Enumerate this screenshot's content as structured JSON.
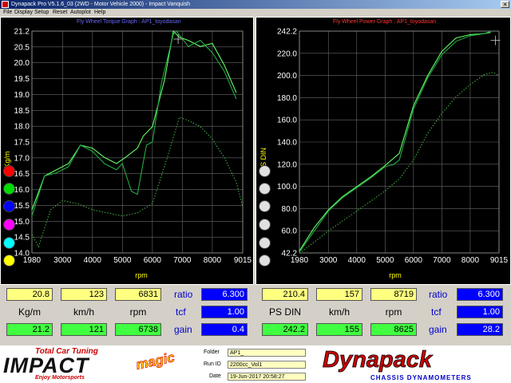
{
  "window": {
    "title": "Dynapack Pro V5.1.6_03 (2WD - Motor Vehicle 2000) - Impact Vanquish",
    "close_glyph": "✕"
  },
  "menu": [
    "File",
    "Display",
    "Setup",
    "Reset",
    "Autoplot",
    "Help"
  ],
  "torque_graph": {
    "title": "Fly Wheel Torque Graph : AP1_toyodasan",
    "ylabel": "Kg/m",
    "xlabel": "rpm",
    "yticks": [
      "21.2",
      "20.5",
      "20.0",
      "19.5",
      "19.0",
      "18.5",
      "18.0",
      "17.5",
      "17.0",
      "16.5",
      "16.0",
      "15.5",
      "15.0",
      "14.5",
      "14.0"
    ],
    "xticks": [
      "1980",
      "3000",
      "4000",
      "5000",
      "6000",
      "7000",
      "8000",
      "9015"
    ],
    "color": "#0000cc"
  },
  "power_graph": {
    "title": "Fly Wheel Power Graph : AP1_toyodasan",
    "ylabel": "PS DIN",
    "xlabel": "rpm",
    "yticks": [
      "242.2",
      "220.0",
      "200.0",
      "180.0",
      "160.0",
      "140.0",
      "120.0",
      "100.0",
      "80.0",
      "60.0",
      "42.2"
    ],
    "xticks": [
      "1980",
      "3000",
      "4000",
      "5000",
      "6000",
      "7000",
      "8000",
      "9015"
    ],
    "color": "#cc0000"
  },
  "chart_data": [
    {
      "type": "line",
      "title": "Fly Wheel Torque Graph : AP1_toyodasan",
      "xlabel": "rpm",
      "ylabel": "Kg/m",
      "xlim": [
        1980,
        9015
      ],
      "ylim": [
        14.0,
        21.2
      ],
      "grid": true,
      "series": [
        {
          "line": "solid-bright",
          "x": [
            1980,
            2400,
            2800,
            3200,
            3600,
            4000,
            4400,
            4800,
            5100,
            5500,
            5700,
            6000,
            6400,
            6700,
            6900,
            7200,
            7600,
            8000,
            8400,
            8800
          ],
          "y": [
            15.4,
            16.5,
            16.7,
            16.9,
            17.5,
            17.4,
            17.1,
            16.9,
            17.1,
            17.4,
            17.8,
            18.1,
            19.6,
            21.2,
            21.0,
            20.9,
            20.7,
            20.8,
            20.1,
            19.2
          ]
        },
        {
          "line": "solid-dark",
          "x": [
            1980,
            2400,
            2800,
            3200,
            3600,
            4000,
            4400,
            4800,
            5000,
            5300,
            5500,
            5800,
            6000,
            6300,
            6700,
            6800,
            7200,
            7600,
            8000,
            8400,
            8800
          ],
          "y": [
            15.2,
            16.5,
            16.6,
            16.8,
            17.5,
            17.3,
            16.9,
            16.7,
            16.9,
            16.0,
            15.9,
            17.5,
            17.6,
            19.5,
            21.1,
            21.2,
            20.7,
            20.9,
            20.5,
            19.9,
            19.0
          ]
        },
        {
          "line": "dotted",
          "x": [
            1980,
            2200,
            2600,
            3000,
            3500,
            4000,
            4500,
            5000,
            5500,
            6000,
            6500,
            6900,
            7200,
            7600,
            8000,
            8400,
            8800,
            9015
          ],
          "y": [
            14.6,
            14.2,
            15.4,
            15.7,
            15.6,
            15.4,
            15.3,
            15.2,
            15.3,
            15.6,
            17.1,
            18.4,
            18.3,
            18.1,
            17.7,
            17.1,
            16.3,
            15.5
          ]
        }
      ]
    },
    {
      "type": "line",
      "title": "Fly Wheel Power Graph : AP1_toyodasan",
      "xlabel": "rpm",
      "ylabel": "PS DIN",
      "xlim": [
        1980,
        9015
      ],
      "ylim": [
        42.2,
        242.2
      ],
      "grid": true,
      "series": [
        {
          "line": "solid-bright",
          "x": [
            1980,
            2500,
            3000,
            3500,
            4000,
            4500,
            5000,
            5500,
            6000,
            6500,
            7000,
            7500,
            8000,
            8500,
            8719
          ],
          "y": [
            44,
            65,
            81,
            93,
            102,
            111,
            121,
            132,
            175,
            202,
            224,
            236,
            239,
            240,
            241
          ]
        },
        {
          "line": "solid-dark",
          "x": [
            1980,
            2500,
            3000,
            3500,
            4000,
            4500,
            5000,
            5300,
            5500,
            6000,
            6500,
            7000,
            7500,
            8000,
            8500,
            8719
          ],
          "y": [
            43,
            62,
            80,
            92,
            101,
            110,
            120,
            122,
            126,
            172,
            200,
            221,
            233,
            238,
            240,
            242
          ]
        },
        {
          "line": "dotted",
          "x": [
            1980,
            2500,
            3000,
            3500,
            4000,
            4500,
            5000,
            5500,
            6000,
            6500,
            7000,
            7500,
            8000,
            8500,
            8800,
            9015
          ],
          "y": [
            42,
            52,
            62,
            71,
            80,
            89,
            98,
            109,
            126,
            150,
            168,
            183,
            194,
            203,
            205,
            202
          ]
        }
      ]
    }
  ],
  "dots": [
    "#ff0000",
    "#00dd00",
    "#0000ff",
    "#ff00ff",
    "#00ffff",
    "#ffff00"
  ],
  "left_readout": {
    "row1": [
      "20.8",
      "123",
      "6831"
    ],
    "units": [
      "Kg/m",
      "km/h",
      "rpm"
    ],
    "row2": [
      "21.2",
      "121",
      "6738"
    ],
    "ratio_label": "ratio",
    "ratio": "6.300",
    "tcf_label": "tcf",
    "tcf": "1.00",
    "gain_label": "gain",
    "gain": "0.4"
  },
  "right_readout": {
    "row1": [
      "210.4",
      "157",
      "8719"
    ],
    "units": [
      "PS DIN",
      "km/h",
      "rpm"
    ],
    "row2": [
      "242.2",
      "155",
      "8625"
    ],
    "ratio_label": "ratio",
    "ratio": "6.300",
    "tcf_label": "tcf",
    "tcf": "1.00",
    "gain_label": "gain",
    "gain": "28.2"
  },
  "footer": {
    "logo_top": "Total Car Tuning",
    "logo_main": "IMPACT",
    "logo_magic": "magic",
    "logo_bottom": "Enjoy Motorsports",
    "folder_label": "Folder",
    "folder": "AP1_",
    "runid_label": "Run ID",
    "runid": "2200cc_Vol1",
    "date_label": "Date",
    "date": "19-Jun-2017  20:58:27",
    "brand": "Dynapack",
    "brand_sub": "CHASSIS   DYNAMOMETERS"
  }
}
